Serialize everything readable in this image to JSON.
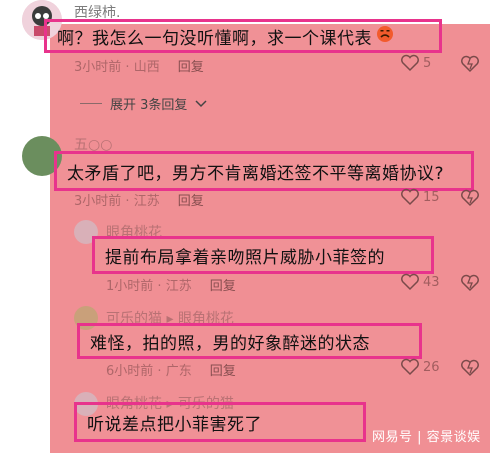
{
  "comments": [
    {
      "author": "西绿柿.",
      "text": "啊？我怎么一句没听懂啊，求一个课代表",
      "time": "3小时前",
      "location": "山西",
      "reply_label": "回复",
      "likes": "5"
    },
    {
      "author": "五○○",
      "text": "太矛盾了吧，男方不肯离婚还签不平等离婚协议?",
      "time": "3小时前",
      "location": "江苏",
      "reply_label": "回复",
      "likes": "15"
    }
  ],
  "expand": {
    "label": "展开 3条回复"
  },
  "replies": [
    {
      "author": "眼角桃花",
      "reply_to": "",
      "text": "提前布局拿着亲吻照片威胁小菲签的",
      "time": "1小时前",
      "location": "江苏",
      "reply_label": "回复",
      "likes": "43"
    },
    {
      "author": "可乐的猫",
      "reply_to": "眼角桃花",
      "text": "难怪，拍的照，男的好象醉迷的状态",
      "time": "6小时前",
      "location": "广东",
      "reply_label": "回复",
      "likes": "26"
    },
    {
      "author": "眼角桃花",
      "reply_to": "可乐的猫",
      "text": "听说差点把小菲害死了",
      "time": "",
      "location": "",
      "reply_label": "",
      "likes": ""
    }
  ],
  "watermark": "网易号 | 容景谈娱",
  "colors": {
    "overlay": "#ec7076",
    "highlight_border": "#e8338c",
    "name": "#7d7d7d"
  }
}
